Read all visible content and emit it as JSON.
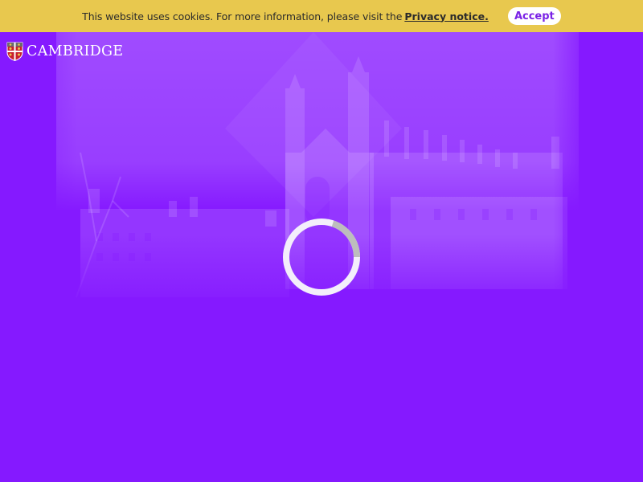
{
  "cookie_banner": {
    "message": "This website uses cookies. For more information, please visit the",
    "link_text": "Privacy notice.",
    "accept_label": "Accept"
  },
  "logo": {
    "wordmark": "CAMBRIDGE",
    "crest_icon": "cambridge-crest-icon"
  },
  "loading": {
    "icon": "loading-spinner-icon"
  },
  "colors": {
    "background": "#8519ff",
    "banner": "#e8c84e",
    "accent": "#7a22e6"
  }
}
